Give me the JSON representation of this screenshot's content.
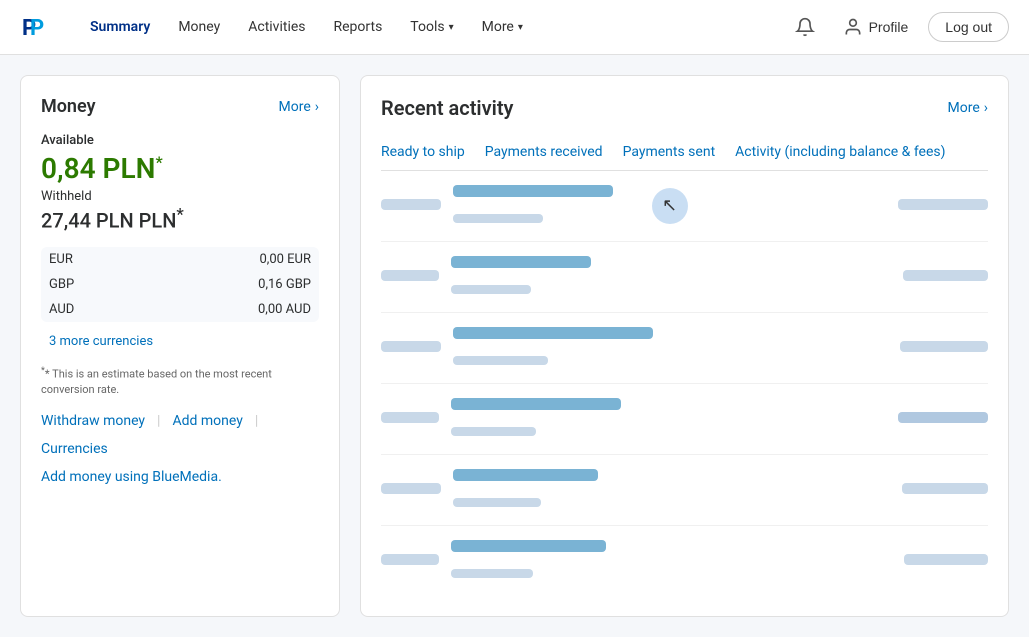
{
  "header": {
    "logo_text": "PayPal",
    "nav": [
      {
        "label": "Summary",
        "active": true,
        "has_dropdown": false
      },
      {
        "label": "Money",
        "active": false,
        "has_dropdown": false
      },
      {
        "label": "Activities",
        "active": false,
        "has_dropdown": false
      },
      {
        "label": "Reports",
        "active": false,
        "has_dropdown": false
      },
      {
        "label": "Tools",
        "active": false,
        "has_dropdown": true
      },
      {
        "label": "More",
        "active": false,
        "has_dropdown": true
      }
    ],
    "profile_label": "Profile",
    "logout_label": "Log out"
  },
  "money_panel": {
    "title": "Money",
    "more_label": "More",
    "available_label": "Available",
    "balance": "0,84 PLN",
    "balance_suffix": "*",
    "withheld_label": "Withheld",
    "withheld_amount": "27,44 PLN PLN",
    "withheld_suffix": "*",
    "currencies": [
      {
        "code": "EUR",
        "amount": "0,00 EUR"
      },
      {
        "code": "GBP",
        "amount": "0,16 GBP"
      },
      {
        "code": "AUD",
        "amount": "0,00 AUD"
      }
    ],
    "more_currencies": "3 more currencies",
    "disclaimer": "* This is an estimate based on the most recent conversion rate.",
    "actions": [
      {
        "label": "Withdraw money"
      },
      {
        "label": "Add money"
      },
      {
        "label": "Currencies"
      }
    ],
    "bluemedia_label": "Add money using BlueMedia."
  },
  "activity_panel": {
    "title": "Recent activity",
    "more_label": "More",
    "tabs": [
      {
        "label": "Ready to ship",
        "active": false
      },
      {
        "label": "Payments received",
        "active": true
      },
      {
        "label": "Payments sent",
        "active": false
      },
      {
        "label": "Activity (including balance & fees)",
        "active": false
      }
    ],
    "rows": [
      {
        "date_width": 60,
        "title_width": 160,
        "sub_width": 90,
        "amount_width": 90,
        "has_cursor": true
      },
      {
        "date_width": 58,
        "title_width": 140,
        "sub_width": 80,
        "amount_width": 85,
        "has_cursor": false
      },
      {
        "date_width": 60,
        "title_width": 200,
        "sub_width": 95,
        "amount_width": 88,
        "has_cursor": false
      },
      {
        "date_width": 58,
        "title_width": 170,
        "sub_width": 85,
        "amount_width": 90,
        "has_cursor": false
      },
      {
        "date_width": 60,
        "title_width": 145,
        "sub_width": 88,
        "amount_width": 86,
        "has_cursor": false
      },
      {
        "date_width": 58,
        "title_width": 155,
        "sub_width": 82,
        "amount_width": 84,
        "has_cursor": false
      }
    ]
  }
}
